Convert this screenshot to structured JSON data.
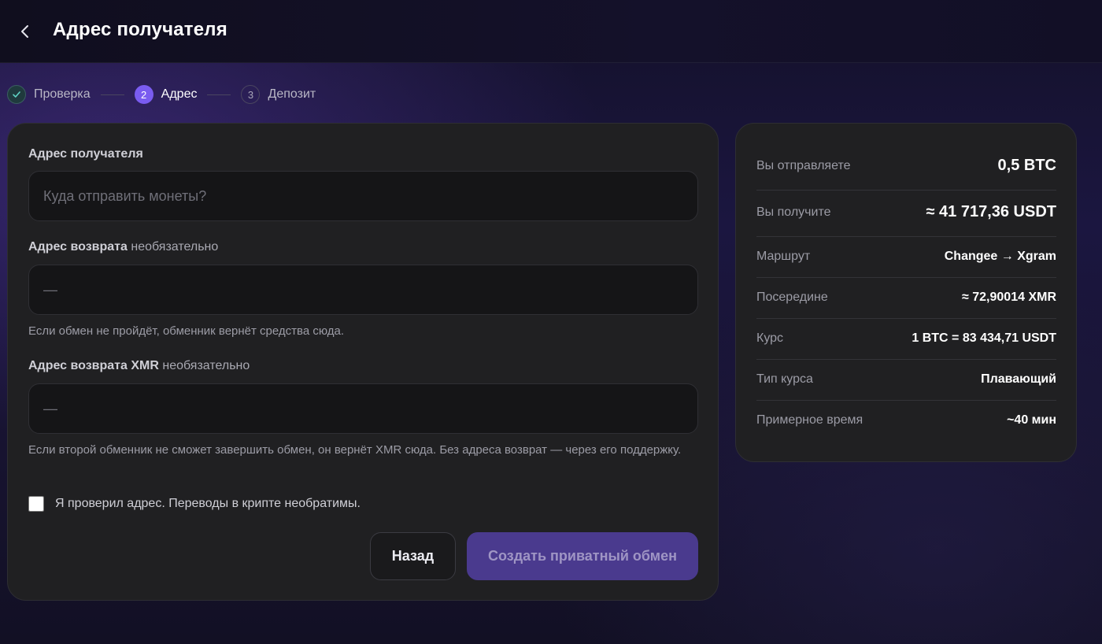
{
  "header": {
    "title": "Адрес получателя"
  },
  "stepper": {
    "steps": [
      {
        "number": "✓",
        "label": "Проверка",
        "state": "done"
      },
      {
        "number": "2",
        "label": "Адрес",
        "state": "active"
      },
      {
        "number": "3",
        "label": "Депозит",
        "state": "pending"
      }
    ]
  },
  "form": {
    "recipient": {
      "label": "Адрес получателя",
      "placeholder": "Куда отправить монеты?",
      "value": ""
    },
    "refund": {
      "label": "Адрес возврата",
      "optional": "необязательно",
      "placeholder": "—",
      "hint": "Если обмен не пройдёт, обменник вернёт средства сюда."
    },
    "refund_xmr": {
      "label": "Адрес возврата XMR",
      "optional": "необязательно",
      "placeholder": "—",
      "hint": "Если второй обменник не сможет завершить обмен, он вернёт XMR сюда. Без адреса возврат — через его поддержку."
    },
    "confirm_label": "Я проверил адрес. Переводы в крипте необратимы.",
    "confirm_checked": false,
    "back_label": "Назад",
    "submit_label": "Создать приватный обмен"
  },
  "summary": {
    "rows": [
      {
        "key": "Вы отправляете",
        "value": "0,5 BTC"
      },
      {
        "key": "Вы получите",
        "value": "≈ 41 717,36 USDT"
      },
      {
        "key": "Маршрут",
        "value": "Changee → Xgram"
      },
      {
        "key": "Посередине",
        "value": "≈ 72,90014 XMR"
      },
      {
        "key": "Курс",
        "value": "1 BTC = 83 434,71 USDT"
      },
      {
        "key": "Тип курса",
        "value": "Плавающий"
      },
      {
        "key": "Примерное время",
        "value": "~40 мин"
      }
    ]
  },
  "colors": {
    "accent": "#7a5cf0",
    "submit_disabled": "#4a3a8e",
    "card": "#202022",
    "input": "#151517"
  }
}
